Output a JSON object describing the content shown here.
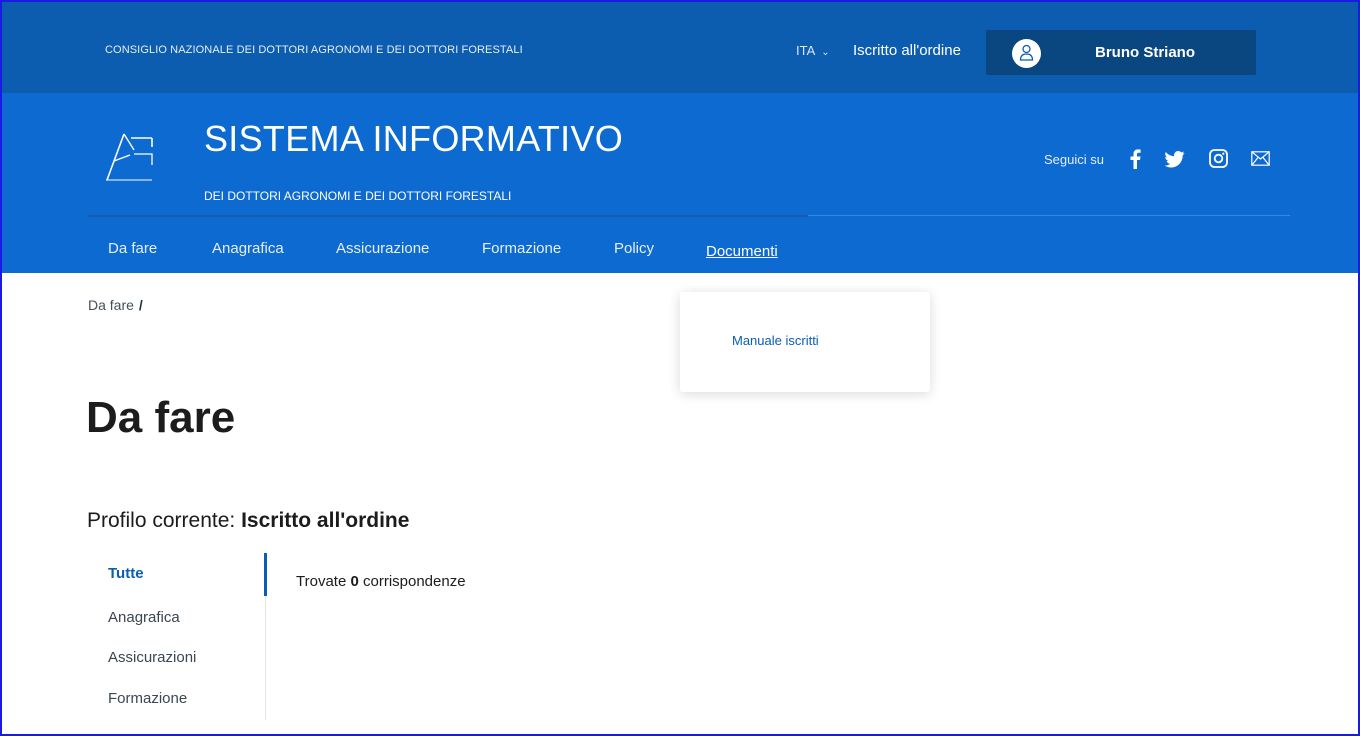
{
  "header": {
    "org_name": "CONSIGLIO NAZIONALE DEI DOTTORI AGRONOMI E DEI DOTTORI FORESTALI",
    "language": "ITA",
    "role": "Iscritto all'ordine",
    "user_name": "Bruno Striano"
  },
  "brand": {
    "title": "SISTEMA INFORMATIVO",
    "subtitle": "DEI DOTTORI AGRONOMI E DEI DOTTORI FORESTALI",
    "social_label": "Seguici su",
    "social_icons": [
      "facebook-icon",
      "twitter-icon",
      "instagram-icon",
      "mail-icon"
    ]
  },
  "nav": {
    "items": [
      "Da fare",
      "Anagrafica",
      "Assicurazione",
      "Formazione",
      "Policy",
      "Documenti"
    ],
    "active": "Documenti"
  },
  "dropdown": {
    "items": [
      "Manuale iscritti"
    ]
  },
  "breadcrumb": {
    "item": "Da fare",
    "separator": "/"
  },
  "page": {
    "title": "Da fare",
    "profile_label": "Profilo corrente:",
    "profile_value": "Iscritto all'ordine"
  },
  "sidebar": {
    "items": [
      "Tutte",
      "Anagrafica",
      "Assicurazioni",
      "Formazione"
    ],
    "active": "Tutte"
  },
  "results": {
    "prefix": "Trovate",
    "count": "0",
    "suffix": "corrispondenze"
  },
  "colors": {
    "slim_bar": "#0c5cb0",
    "header": "#0d6ad1",
    "user_box": "#0a467f",
    "accent": "#0b5cb5"
  }
}
